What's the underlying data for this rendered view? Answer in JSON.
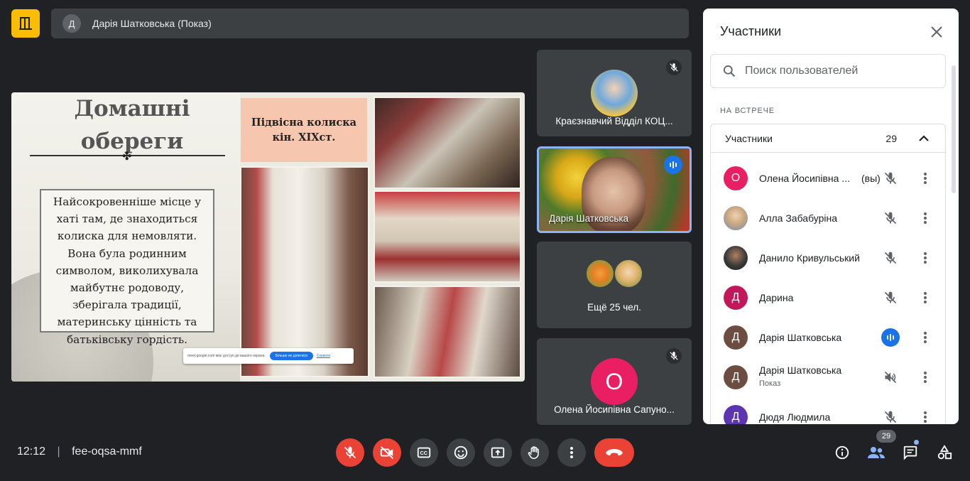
{
  "header": {
    "presenter_initial": "Д",
    "presenter_name": "Дарія Шатковська (Показ)"
  },
  "slide": {
    "title_line1": "Домашні",
    "title_line2": "обереги",
    "ornament": "✤",
    "body_text": "Найсокровенніше місце у хаті там, де знаходиться колиска для немовляти. Вона була родинним символом, виколихувала майбутнє родоводу, зберігала традиції, материнську цінність та батьківську гордість.",
    "caption": "Підвісна колиска кін. XIXст.",
    "share_popup": {
      "text": "meet.google.com має доступ до вашого екрана.",
      "stop_button": "Більше не ділитися",
      "hide_button": "Сховати"
    }
  },
  "tiles": [
    {
      "name": "Краєзнавчий Відділ КОЦ...",
      "muted": true
    },
    {
      "name": "Дарія Шатковська",
      "speaking": true
    },
    {
      "label": "Ещё 25 чел."
    },
    {
      "initial": "О",
      "name": "Олена Йосипівна Сапуно...",
      "muted": true,
      "avatar_color": "#e91e63"
    }
  ],
  "panel": {
    "title": "Участники",
    "search_placeholder": "Поиск пользователей",
    "section": "НА ВСТРЕЧЕ",
    "group_label": "Участники",
    "group_count": "29",
    "participants": [
      {
        "initial": "О",
        "name": "Олена Йосипівна ...",
        "suffix": "(вы)",
        "color": "#e91e63",
        "mic": "muted"
      },
      {
        "initial": "",
        "name": "Алла Забабуріна",
        "color": "#6d8bb0",
        "mic": "muted"
      },
      {
        "initial": "",
        "name": "Данило Кривульський",
        "color": "#2b2b2b",
        "mic": "muted"
      },
      {
        "initial": "Д",
        "name": "Дарина",
        "color": "#c2185b",
        "mic": "muted"
      },
      {
        "initial": "Д",
        "name": "Дарія Шатковська",
        "color": "#6d4c41",
        "mic": "speaking"
      },
      {
        "initial": "Д",
        "name": "Дарія Шатковська",
        "sub": "Показ",
        "color": "#6d4c41",
        "mic": "audio-off"
      },
      {
        "initial": "Д",
        "name": "Дюдя Людмила",
        "color": "#5e35b1",
        "mic": "muted"
      }
    ]
  },
  "footer": {
    "time": "12:12",
    "separator": "|",
    "meeting_code": "fee-oqsa-mmf",
    "people_badge": "29"
  },
  "colors": {
    "background": "#202124",
    "accent_blue": "#1a73e8",
    "danger_red": "#ea4335",
    "brand_yellow": "#fbbc04"
  }
}
